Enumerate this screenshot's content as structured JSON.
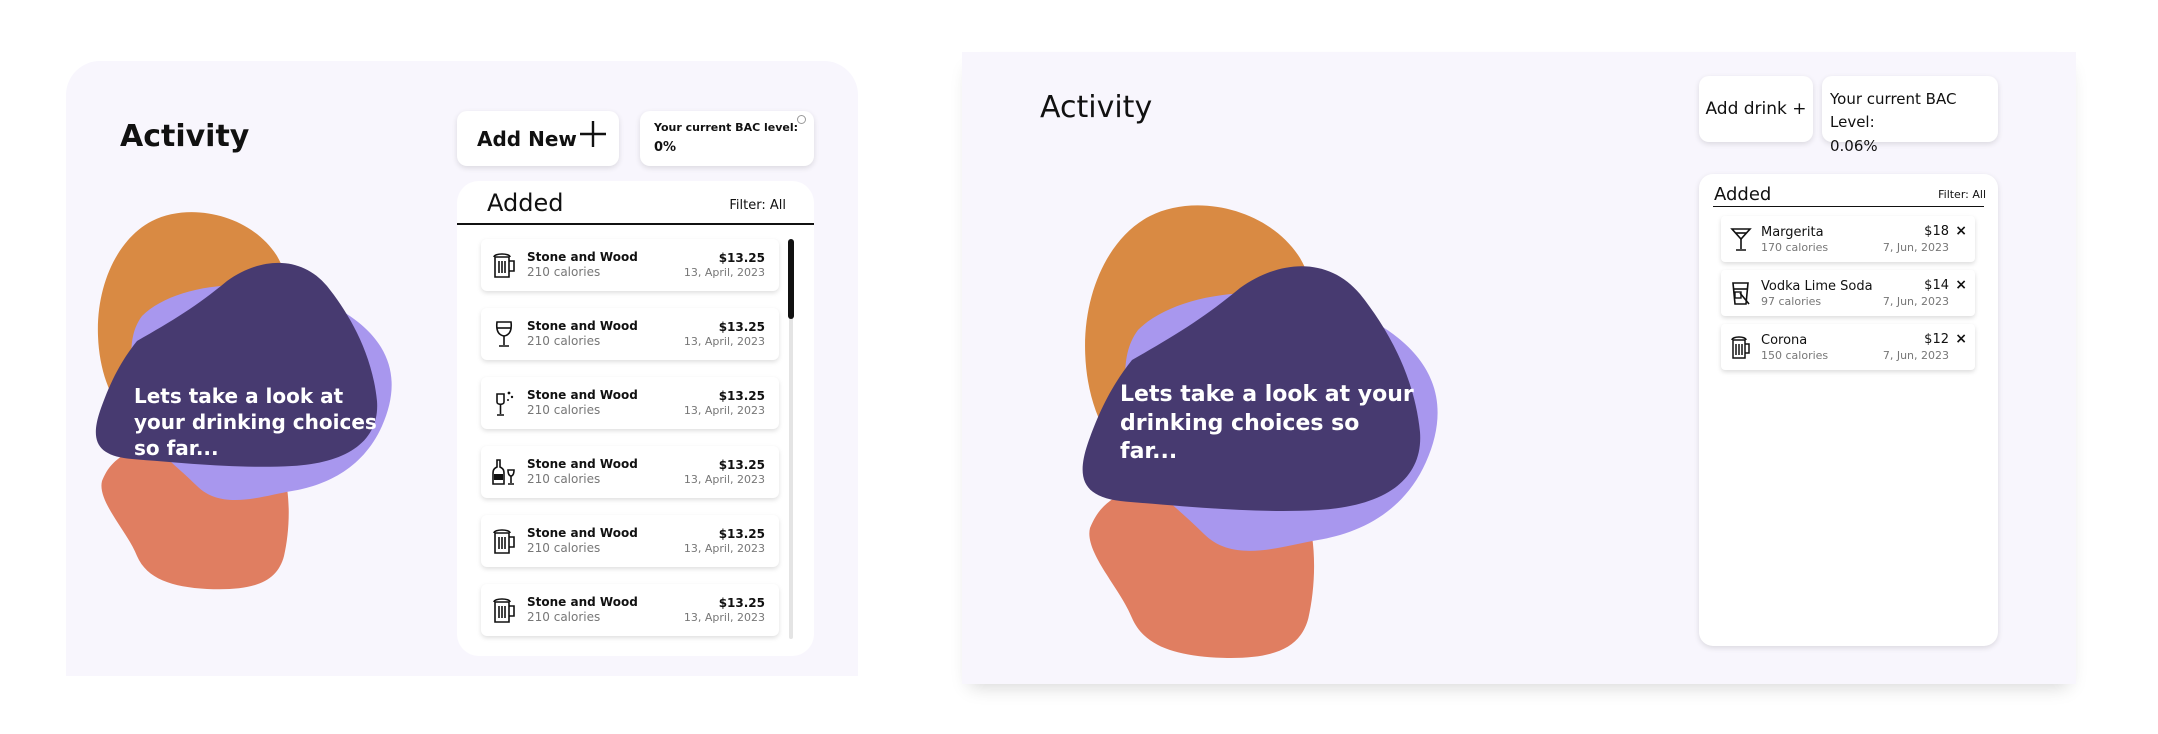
{
  "colors": {
    "orange": "#d98a43",
    "lavender": "#a897ee",
    "purple": "#473a70",
    "coral": "#e07e61",
    "bg": "#f8f6fd"
  },
  "screen1": {
    "title": "Activity",
    "add_new_label": "Add New",
    "bac": {
      "label": "Your current BAC level:",
      "value": "0%"
    },
    "blob_text": "Lets take a look at your drinking choices so far...",
    "list": {
      "header": "Added",
      "filter": "Filter: All",
      "items": [
        {
          "icon": "beer-mug-icon",
          "name": "Stone and Wood",
          "calories": "210 calories",
          "price": "$13.25",
          "date": "13, April, 2023"
        },
        {
          "icon": "wine-glass-icon",
          "name": "Stone and Wood",
          "calories": "210 calories",
          "price": "$13.25",
          "date": "13, April, 2023"
        },
        {
          "icon": "champagne-glass-icon",
          "name": "Stone and Wood",
          "calories": "210 calories",
          "price": "$13.25",
          "date": "13, April, 2023"
        },
        {
          "icon": "wine-bottle-icon",
          "name": "Stone and Wood",
          "calories": "210 calories",
          "price": "$13.25",
          "date": "13, April, 2023"
        },
        {
          "icon": "beer-mug-icon",
          "name": "Stone and Wood",
          "calories": "210 calories",
          "price": "$13.25",
          "date": "13, April, 2023"
        },
        {
          "icon": "beer-mug-icon",
          "name": "Stone and Wood",
          "calories": "210 calories",
          "price": "$13.25",
          "date": "13, April, 2023"
        }
      ]
    }
  },
  "screen2": {
    "title": "Activity",
    "add_drink_label": "Add drink +",
    "bac": {
      "label": "Your current BAC Level:",
      "value": "0.06%"
    },
    "blob_text": "Lets take a look at your drinking choices so far...",
    "list": {
      "header": "Added",
      "filter": "Filter: All",
      "items": [
        {
          "icon": "cocktail-glass-icon",
          "name": "Margerita",
          "calories": "170 calories",
          "price": "$18",
          "date": "7, Jun, 2023",
          "remove": "×"
        },
        {
          "icon": "highball-glass-icon",
          "name": "Vodka Lime Soda",
          "calories": "97 calories",
          "price": "$14",
          "date": "7, Jun, 2023",
          "remove": "×"
        },
        {
          "icon": "beer-mug-icon",
          "name": "Corona",
          "calories": "150 calories",
          "price": "$12",
          "date": "7, Jun, 2023",
          "remove": "×"
        }
      ]
    }
  }
}
